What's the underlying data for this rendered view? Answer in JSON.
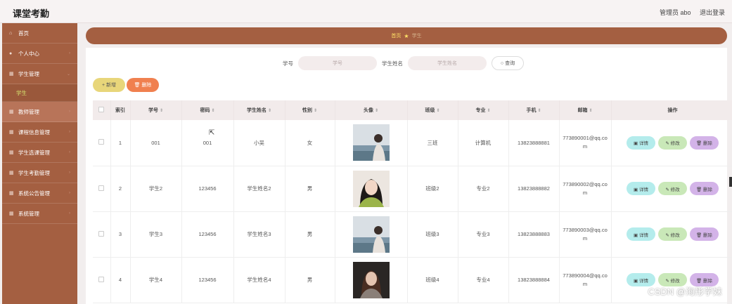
{
  "app": {
    "title": "课堂考勤"
  },
  "header": {
    "user_label": "管理员 abo",
    "logout_label": "退出登录"
  },
  "sidebar": {
    "items": [
      {
        "label": "首页",
        "icon": "home-icon"
      },
      {
        "label": "个人中心",
        "icon": "user-icon"
      },
      {
        "label": "学生管理",
        "icon": "grid-icon"
      },
      {
        "label": "教师管理",
        "icon": "grid-icon"
      },
      {
        "label": "课程信息管理",
        "icon": "grid-icon"
      },
      {
        "label": "学生选课管理",
        "icon": "grid-icon"
      },
      {
        "label": "学生考勤管理",
        "icon": "grid-icon"
      },
      {
        "label": "系统公告管理",
        "icon": "grid-icon"
      },
      {
        "label": "系统管理",
        "icon": "grid-icon"
      }
    ],
    "sub_item": {
      "label": "学生"
    }
  },
  "breadcrumb": {
    "home": "首页",
    "separator": "★",
    "current": "学生"
  },
  "search": {
    "student_no_label": "学号",
    "student_no_placeholder": "学号",
    "name_label": "学生姓名",
    "name_placeholder": "学生姓名",
    "query_label": "○ 查询"
  },
  "actions": {
    "add_label": "+ 新增",
    "delete_label": "🗑 删除"
  },
  "table": {
    "columns": [
      "索引",
      "学号",
      "密码",
      "学生姓名",
      "性别",
      "头像",
      "班级",
      "专业",
      "手机",
      "邮箱",
      "操作"
    ],
    "sort_glyph": "⇕",
    "op_labels": {
      "detail": "▣ 详情",
      "edit": "✎ 修改",
      "delete": "🗑 删除"
    },
    "rows": [
      {
        "index": "1",
        "student_no": "001",
        "password": "001",
        "name": "小吴",
        "gender": "女",
        "class": "三班",
        "major": "计算机",
        "phone": "13823888881",
        "email": "773890001@qq.com"
      },
      {
        "index": "2",
        "student_no": "学生2",
        "password": "123456",
        "name": "学生姓名2",
        "gender": "男",
        "class": "班级2",
        "major": "专业2",
        "phone": "13823888882",
        "email": "773890002@qq.com"
      },
      {
        "index": "3",
        "student_no": "学生3",
        "password": "123456",
        "name": "学生姓名3",
        "gender": "男",
        "class": "班级3",
        "major": "专业3",
        "phone": "13823888883",
        "email": "773890003@qq.com"
      },
      {
        "index": "4",
        "student_no": "学生4",
        "password": "123456",
        "name": "学生姓名4",
        "gender": "男",
        "class": "班级4",
        "major": "专业4",
        "phone": "13823888884",
        "email": "773890004@qq.com"
      }
    ]
  },
  "watermark": "CSDN @海彤学妹",
  "colors": {
    "sidebar": "#a45f41",
    "accent_yellow": "#ffe266",
    "add": "#e8d67a",
    "delete": "#f0804f"
  }
}
